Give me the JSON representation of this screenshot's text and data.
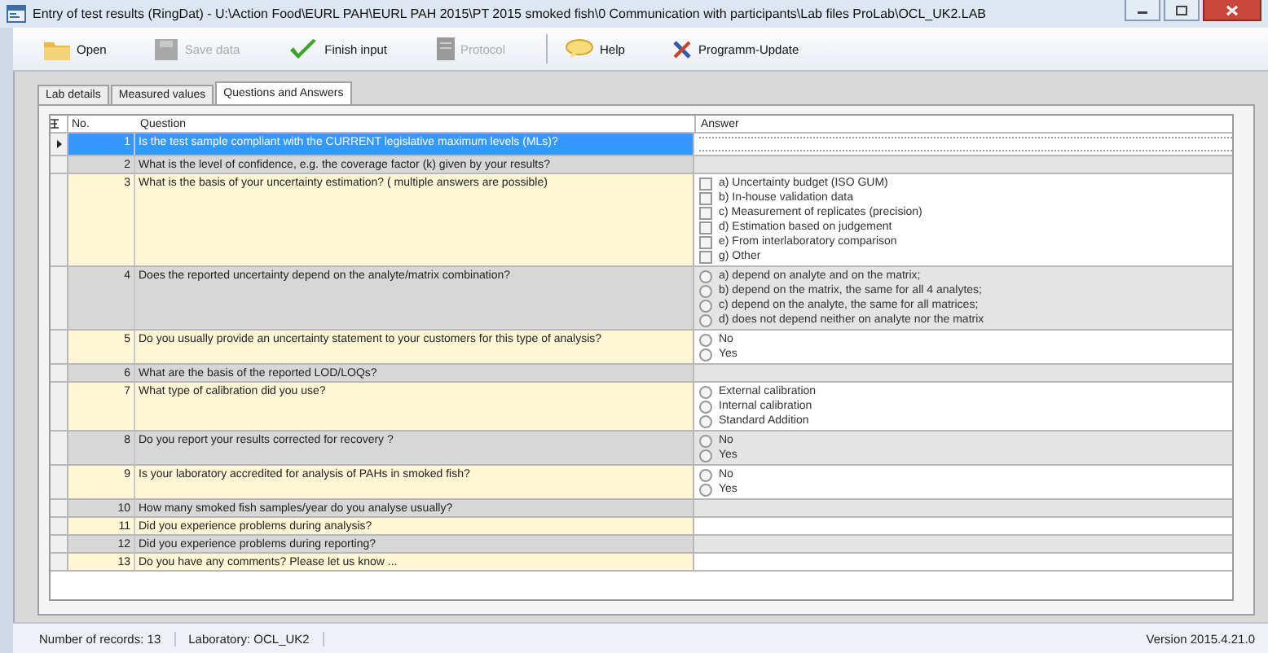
{
  "window": {
    "title": "Entry of test results (RingDat) - U:\\Action Food\\EURL PAH\\EURL PAH 2015\\PT 2015 smoked fish\\0 Communication with participants\\Lab files ProLab\\OCL_UK2.LAB"
  },
  "toolbar": [
    {
      "kind": "open",
      "label": "Open",
      "disabled": false
    },
    {
      "kind": "save",
      "label": "Save data",
      "disabled": true
    },
    {
      "kind": "finish",
      "label": "Finish input",
      "disabled": false
    },
    {
      "kind": "protocol",
      "label": "Protocol",
      "disabled": true
    },
    {
      "kind": "help",
      "label": "Help",
      "disabled": false
    },
    {
      "kind": "update",
      "label": "Programm-Update",
      "disabled": false
    }
  ],
  "tabs": [
    {
      "label": "Lab details",
      "selected": false
    },
    {
      "label": "Measured values",
      "selected": false
    },
    {
      "label": "Questions and Answers",
      "selected": true
    }
  ],
  "table": {
    "columns": [
      "No.",
      "Question",
      "Answer"
    ],
    "rows": [
      {
        "no": "1",
        "question": "Is the test sample compliant with the CURRENT legislative maximum levels (MLs)?",
        "selected": true,
        "answer": {
          "kind": "text"
        }
      },
      {
        "no": "2",
        "question": "What is the level of confidence, e.g. the coverage factor (k) given by your results?",
        "selected": false
      },
      {
        "no": "3",
        "question": "What is the basis of your uncertainty estimation? ( multiple answers are possible)",
        "selected": false,
        "answer": {
          "kind": "checkboxes",
          "options": [
            {
              "label": "a) Uncertainty budget (ISO GUM)",
              "checked": false
            },
            {
              "label": "b) In-house validation data",
              "checked": false
            },
            {
              "label": "c) Measurement of replicates (precision)",
              "checked": false
            },
            {
              "label": "d) Estimation based on judgement",
              "checked": false
            },
            {
              "label": "e) From interlaboratory comparison",
              "checked": false
            },
            {
              "label": "g) Other",
              "checked": false
            }
          ]
        }
      },
      {
        "no": "4",
        "question": "Does the reported uncertainty depend on the analyte/matrix combination?",
        "selected": false,
        "answer": {
          "kind": "radios",
          "options": [
            {
              "label": "a) depend on analyte and on the matrix;",
              "selected": false
            },
            {
              "label": "b) depend on the matrix, the same for all 4 analytes;",
              "selected": false
            },
            {
              "label": "c) depend on the analyte, the same for all matrices;",
              "selected": false
            },
            {
              "label": "d) does not depend neither on analyte nor the matrix",
              "selected": false
            }
          ]
        }
      },
      {
        "no": "5",
        "question": "Do you usually provide an uncertainty statement to your customers for this type of analysis?",
        "selected": false,
        "answer": {
          "kind": "radios",
          "options": [
            {
              "label": "No",
              "selected": false
            },
            {
              "label": "Yes",
              "selected": false
            }
          ]
        }
      },
      {
        "no": "6",
        "question": "What are the basis of the reported LOD/LOQs?",
        "selected": false
      },
      {
        "no": "7",
        "question": "What type of calibration did you use?",
        "selected": false,
        "answer": {
          "kind": "radios",
          "options": [
            {
              "label": "External calibration",
              "selected": false
            },
            {
              "label": "Internal calibration",
              "selected": false
            },
            {
              "label": "Standard Addition",
              "selected": false
            }
          ]
        }
      },
      {
        "no": "8",
        "question": "Do you report your results corrected for recovery ?",
        "selected": false,
        "answer": {
          "kind": "radios",
          "options": [
            {
              "label": "No",
              "selected": false
            },
            {
              "label": "Yes",
              "selected": false
            }
          ]
        }
      },
      {
        "no": "9",
        "question": "Is your laboratory accredited for analysis of PAHs in smoked fish?",
        "selected": false,
        "answer": {
          "kind": "radios",
          "options": [
            {
              "label": "No",
              "selected": false
            },
            {
              "label": "Yes",
              "selected": false
            }
          ]
        }
      },
      {
        "no": "10",
        "question": "How many smoked fish samples/year do you analyse usually?",
        "selected": false
      },
      {
        "no": "11",
        "question": "Did you experience problems during analysis?",
        "selected": false
      },
      {
        "no": "12",
        "question": "Did you experience problems during reporting?",
        "selected": false
      },
      {
        "no": "13",
        "question": "Do you have any comments? Please let us know ...",
        "selected": false
      }
    ]
  },
  "status_bar": {
    "records": "Number of records: 13",
    "laboratory": "Laboratory: OCL_UK2",
    "version": "Version 2015.4.21.0"
  }
}
